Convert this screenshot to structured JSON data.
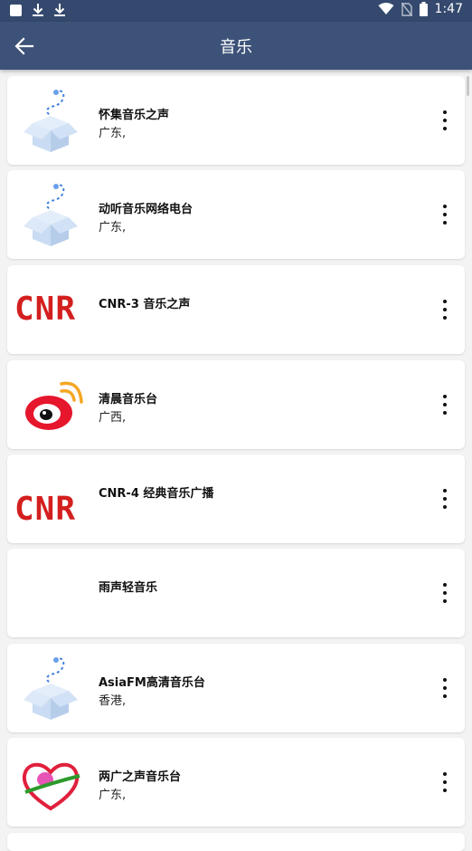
{
  "status_bar": {
    "time": "1:47",
    "icons": [
      "app-square-icon",
      "download-icon",
      "download-icon",
      "wifi-icon",
      "no-sim-icon",
      "battery-icon"
    ]
  },
  "app_bar": {
    "title": "音乐",
    "back_icon": "arrow-back-icon"
  },
  "stations": [
    {
      "name": "怀集音乐之声",
      "region": "广东,",
      "thumb": "box-icon"
    },
    {
      "name": "动听音乐网络电台",
      "region": "广东,",
      "thumb": "box-icon"
    },
    {
      "name": "CNR-3 音乐之声",
      "region": "",
      "thumb": "cnr-logo"
    },
    {
      "name": "清晨音乐台",
      "region": "广西,",
      "thumb": "weibo-logo"
    },
    {
      "name": "CNR-4 经典音乐广播",
      "region": "",
      "thumb": "cnr-logo"
    },
    {
      "name": "雨声轻音乐",
      "region": "",
      "thumb": "none"
    },
    {
      "name": "AsiaFM高清音乐台",
      "region": "香港,",
      "thumb": "box-icon"
    },
    {
      "name": "两广之声音乐台",
      "region": "广东,",
      "thumb": "heart-logo"
    }
  ],
  "logo_text": {
    "cnr": "CNR"
  },
  "colors": {
    "status_bar": "#34496d",
    "app_bar": "#3c5278",
    "background": "#f3f3f3",
    "cnr_red": "#d41f1f"
  }
}
